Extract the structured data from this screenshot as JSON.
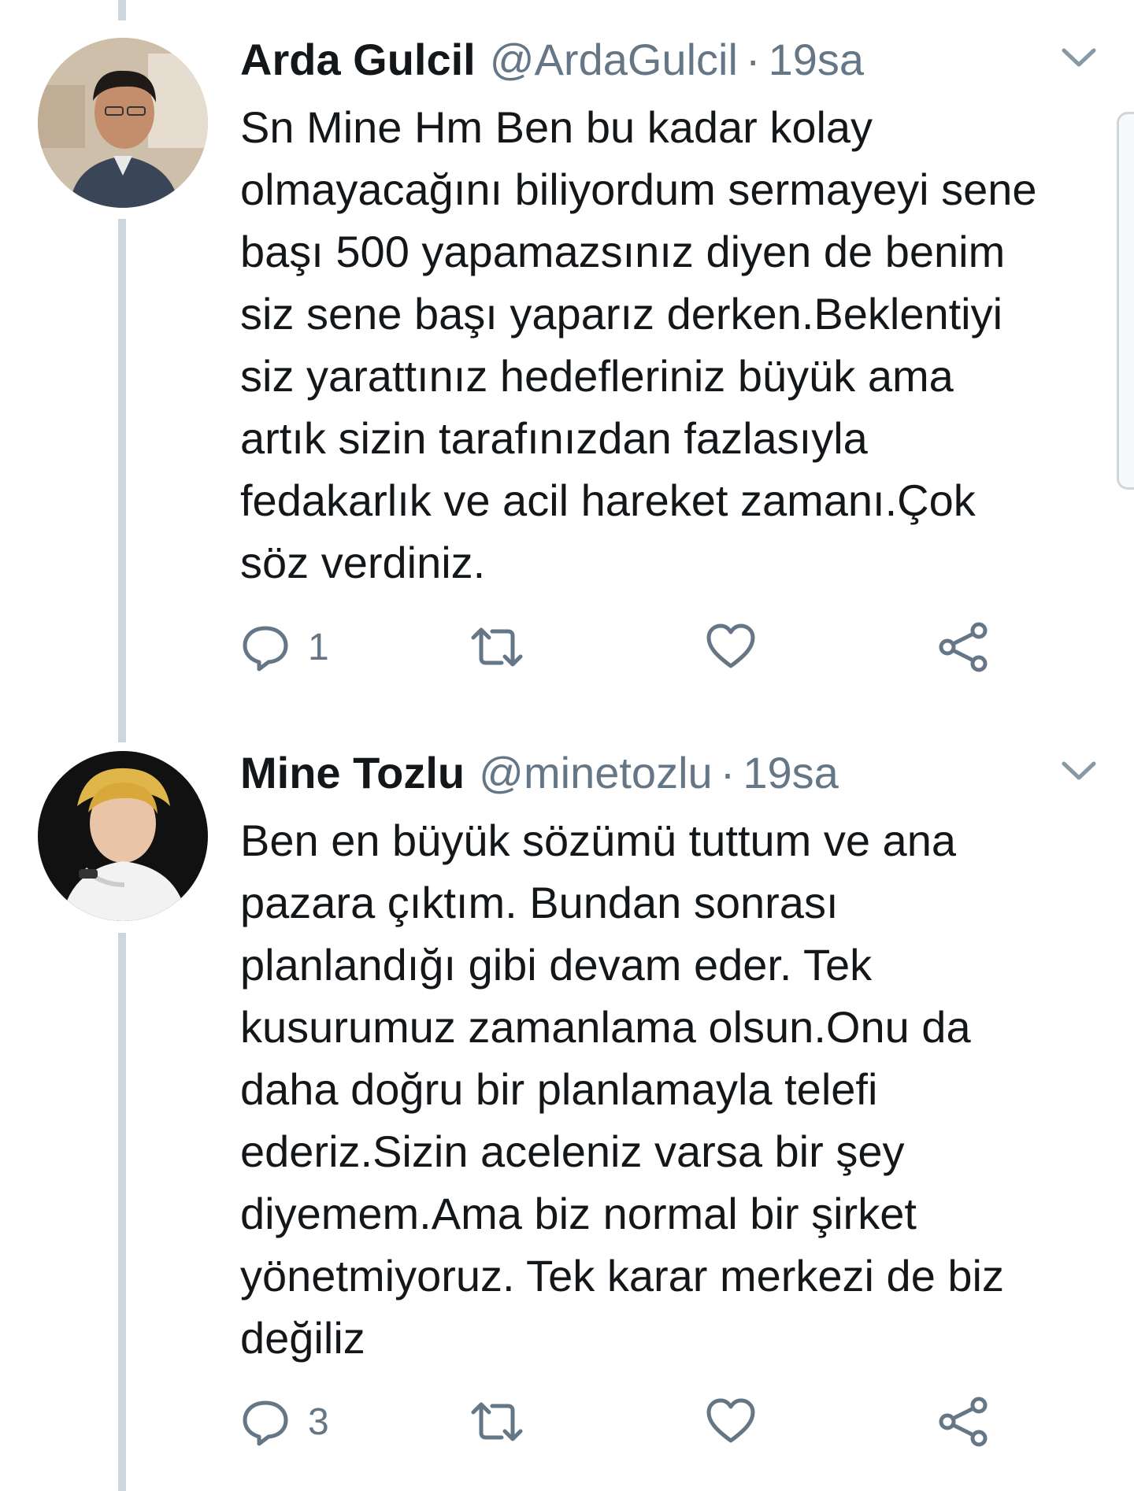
{
  "tweets": [
    {
      "name": "Arda Gulcil",
      "handle": "@ArdaGulcil",
      "separator": "·",
      "time": "19sa",
      "avatar_icon": "profile-photo-man",
      "text_lines": [
        "Sn Mine Hm Ben bu kadar kolay",
        "olmayacağını biliyordum sermayeyi sene",
        "başı 500 yapamazsınız diyen de benim",
        "siz sene başı yaparız derken.Beklentiyi",
        "siz yarattınız hedefleriniz büyük ama",
        "artık sizin tarafınızdan fazlasıyla",
        "fedakarlık ve acil hareket zamanı.Çok",
        "söz verdiniz."
      ],
      "reply_count": "1",
      "retweet_count": "",
      "like_count": ""
    },
    {
      "name": "Mine Tozlu",
      "handle": "@minetozlu",
      "separator": "·",
      "time": "19sa",
      "avatar_icon": "profile-photo-woman",
      "text_lines": [
        "Ben en büyük sözümü tuttum ve ana",
        "pazara çıktım. Bundan sonrası",
        "planlandığı gibi devam eder. Tek",
        "kusurumuz zamanlama olsun.Onu da",
        "daha doğru bir planlamayla telefi",
        "ederiz.Sizin aceleniz varsa bir şey",
        "diyemem.Ama biz normal bir şirket",
        "yönetmiyoruz. Tek karar merkezi de biz",
        "değiliz"
      ],
      "reply_count": "3",
      "retweet_count": "",
      "like_count": ""
    }
  ],
  "icons": {
    "reply": "reply-icon",
    "retweet": "retweet-icon",
    "like": "heart-icon",
    "share": "share-icon",
    "menu": "chevron-down-icon"
  },
  "colors": {
    "text": "#14171a",
    "secondary": "#657786",
    "thread_line": "#ccd6dd"
  }
}
